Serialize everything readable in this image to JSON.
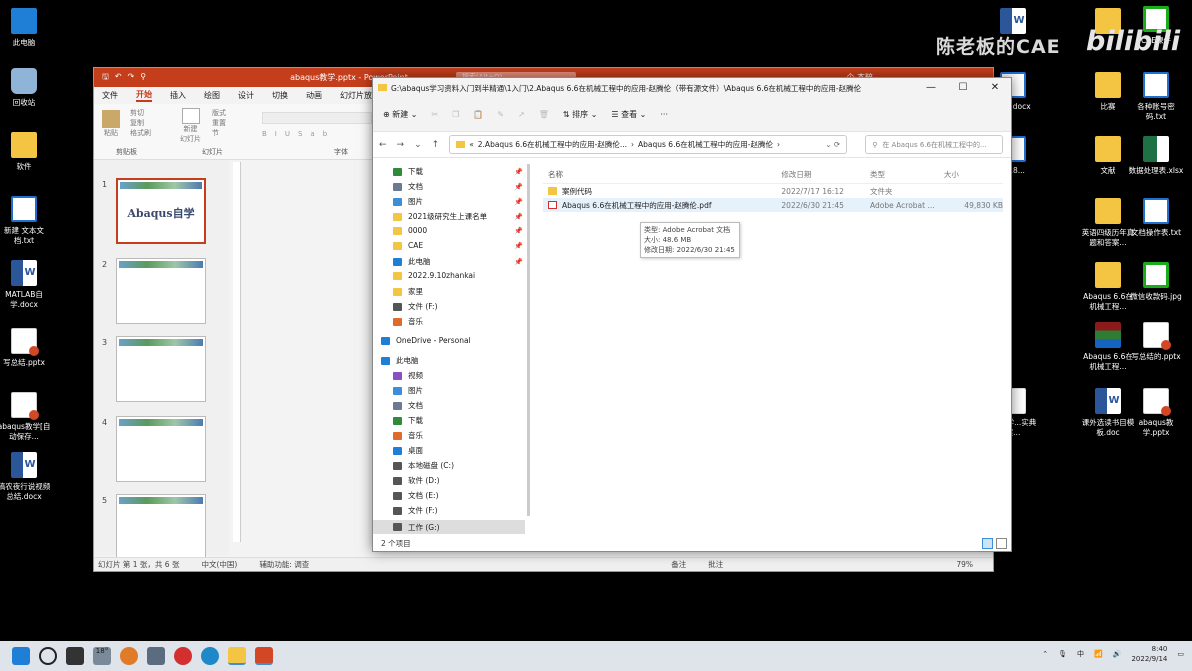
{
  "desktop": {
    "left_icons": [
      {
        "label": "此电脑",
        "icon": "pc"
      },
      {
        "label": "回收站",
        "icon": "bin"
      },
      {
        "label": "软件",
        "icon": "folder"
      },
      {
        "label": "新建 文本文档.txt",
        "icon": "txt"
      },
      {
        "label": "MATLAB自学.docx",
        "icon": "word"
      },
      {
        "label": "写总结.pptx",
        "icon": "ppt"
      },
      {
        "label": "abaqus教学[自动保存...",
        "icon": "ppt"
      },
      {
        "label": "稿农夜行说视频总结.docx",
        "icon": "word"
      }
    ],
    "right_icons": [
      {
        "label": "",
        "icon": "word"
      },
      {
        "label": "",
        "icon": "folder"
      },
      {
        "label": "CAE课件",
        "icon": "qr"
      },
      {
        "label": "总结.docx",
        "icon": "txt"
      },
      {
        "label": "比赛",
        "icon": "folder"
      },
      {
        "label": "各种账号密码.txt",
        "icon": "txt"
      },
      {
        "label": "8.18...",
        "icon": "txt"
      },
      {
        "label": "文献",
        "icon": "folder"
      },
      {
        "label": "数据处理表.xlsx",
        "icon": "xls"
      },
      {
        "label": "英语四级历年真题和答案...",
        "icon": "folder"
      },
      {
        "label": "文档操作表.txt",
        "icon": "txt"
      },
      {
        "label": "Abaqus 6.6在机械工程...",
        "icon": "folder"
      },
      {
        "label": "微信收款码.jpg",
        "icon": "qr"
      },
      {
        "label": "Abaqus 6.6在机械工程...",
        "icon": "rar"
      },
      {
        "label": "写总结的.pptx",
        "icon": "ppt"
      },
      {
        "label": "ab教学...实典案...",
        "icon": "pdf"
      },
      {
        "label": "课外选读书目模板.doc",
        "icon": "word"
      },
      {
        "label": "abaqus教学.pptx",
        "icon": "ppt"
      }
    ],
    "watermark": "陈老板的CAE",
    "bili_logo": "bilibili"
  },
  "powerpoint": {
    "filename": "abaqus教学.pptx - PowerPoint",
    "search_placeholder": "搜索(Alt+Q)",
    "user": "企 杰粹",
    "tabs": [
      "文件",
      "开始",
      "插入",
      "绘图",
      "设计",
      "切换",
      "动画",
      "幻灯片放映"
    ],
    "active_tab": "开始",
    "ribbon": {
      "paste": "粘贴",
      "cut": "剪切",
      "copy": "复制",
      "format_painter": "格式刷",
      "clipboard_label": "剪贴板",
      "new_slide": "新建\n幻灯片",
      "layout": "版式",
      "reset": "重置",
      "section": "节",
      "slides_label": "幻灯片",
      "font_label": "字体"
    },
    "slides": [
      {
        "num": "1",
        "title": "Abaqus自学"
      },
      {
        "num": "2",
        "title": ""
      },
      {
        "num": "3",
        "title": ""
      },
      {
        "num": "4",
        "title": ""
      },
      {
        "num": "5",
        "title": ""
      }
    ],
    "status": {
      "slide_info": "幻灯片 第 1 张，共 6 张",
      "language": "中文(中国)",
      "accessibility": "辅助功能: 调查",
      "notes": "备注",
      "comments": "批注",
      "zoom": "79%"
    }
  },
  "explorer": {
    "title": "G:\\abaqus学习资料入门到半精通\\1入门\\2.Abaqus 6.6在机械工程中的应用-赵腾伦（带有源文件）\\Abaqus 6.6在机械工程中的应用-赵腾伦",
    "toolbar": {
      "new": "新建",
      "sort": "排序",
      "view": "查看",
      "more": "···"
    },
    "breadcrumb": [
      "«",
      "2.Abaqus 6.6在机械工程中的应用-赵腾伦...",
      "Abaqus 6.6在机械工程中的应用-赵腾伦"
    ],
    "search_placeholder": "在 Abaqus 6.6在机械工程中的...",
    "nav_items": [
      {
        "label": "下载",
        "pinned": true,
        "color": "#2f8a3c"
      },
      {
        "label": "文档",
        "pinned": true,
        "color": "#6b7a90"
      },
      {
        "label": "图片",
        "pinned": true,
        "color": "#3c8fd6"
      },
      {
        "label": "2021级研究生上课名单",
        "pinned": true,
        "color": "#f4c542"
      },
      {
        "label": "0000",
        "pinned": true,
        "color": "#f4c542"
      },
      {
        "label": "CAE",
        "pinned": true,
        "color": "#f4c542"
      },
      {
        "label": "此电脑",
        "pinned": true,
        "color": "#1f7fd6"
      },
      {
        "label": "2022.9.10zhankai",
        "pinned": false,
        "color": "#f4c542"
      },
      {
        "label": "家里",
        "pinned": false,
        "color": "#f4c542"
      },
      {
        "label": "文件 (F:)",
        "pinned": false,
        "color": "#555"
      },
      {
        "label": "音乐",
        "pinned": false,
        "color": "#e06a2c"
      },
      {
        "label": "OneDrive - Personal",
        "pinned": false,
        "color": "#1f7fd6"
      },
      {
        "label": "此电脑",
        "pinned": false,
        "color": "#1f7fd6"
      },
      {
        "label": "视频",
        "pinned": false,
        "color": "#8a4fc2"
      },
      {
        "label": "图片",
        "pinned": false,
        "color": "#3c8fd6"
      },
      {
        "label": "文档",
        "pinned": false,
        "color": "#6b7a90"
      },
      {
        "label": "下载",
        "pinned": false,
        "color": "#2f8a3c"
      },
      {
        "label": "音乐",
        "pinned": false,
        "color": "#e06a2c"
      },
      {
        "label": "桌面",
        "pinned": false,
        "color": "#1f7fd6"
      },
      {
        "label": "本地磁盘 (C:)",
        "pinned": false,
        "color": "#555"
      },
      {
        "label": "软件 (D:)",
        "pinned": false,
        "color": "#555"
      },
      {
        "label": "文档 (E:)",
        "pinned": false,
        "color": "#555"
      },
      {
        "label": "文件 (F:)",
        "pinned": false,
        "color": "#555"
      },
      {
        "label": "工作 (G:)",
        "pinned": false,
        "color": "#555"
      }
    ],
    "selected_nav": "工作 (G:)",
    "columns": [
      "名称",
      "修改日期",
      "类型",
      "大小"
    ],
    "files": [
      {
        "name": "案例代码",
        "date": "2022/7/17 16:12",
        "type": "文件夹",
        "size": "",
        "kind": "folder"
      },
      {
        "name": "Abaqus 6.6在机械工程中的应用-赵腾伦.pdf",
        "date": "2022/6/30 21:45",
        "type": "Adobe Acrobat ...",
        "size": "49,830 KB",
        "kind": "pdf"
      }
    ],
    "tooltip": {
      "type": "类型: Adobe Acrobat 文档",
      "size": "大小: 48.6 MB",
      "date": "修改日期: 2022/6/30 21:45"
    },
    "status": "2 个项目"
  },
  "taskbar": {
    "weather": "18°",
    "time": "8:40",
    "date": "2022/9/14"
  }
}
